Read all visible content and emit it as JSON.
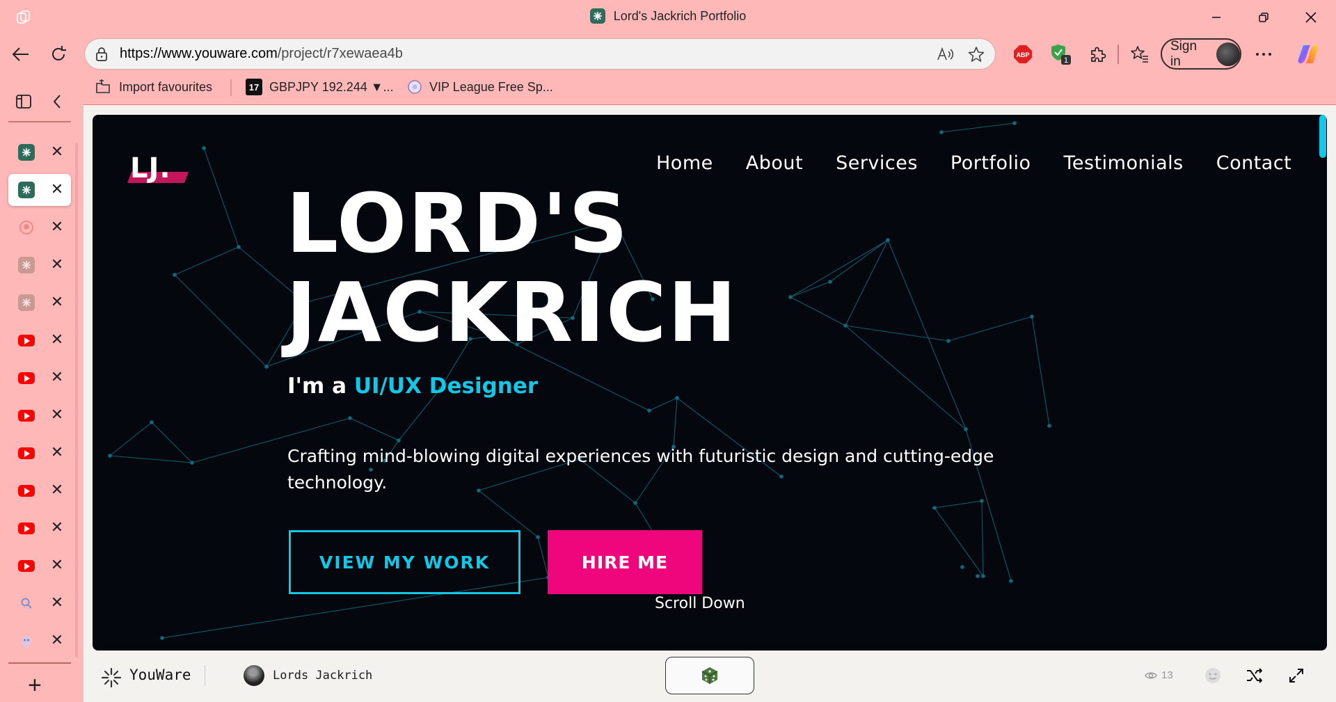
{
  "window": {
    "title": "Lord's Jackrich Portfolio",
    "minimize_icon": "minimize-icon",
    "restore_icon": "restore-icon",
    "close_icon": "close-icon"
  },
  "toolbar": {
    "url_host": "https://www.youware.com",
    "url_path": "/project/r7xewaea4b",
    "signin_label": "Sign in",
    "extension_badge": "1",
    "adblock_label": "ABP"
  },
  "favourites": [
    {
      "label": "Import favourites",
      "icon": "import-icon"
    },
    {
      "label": "GBPJPY 192.244 ▼...",
      "icon": "tradingview-icon",
      "badge": "17"
    },
    {
      "label": "VIP League Free Sp...",
      "icon": "vipleague-icon"
    }
  ],
  "sidebar": {
    "tabs": [
      {
        "icon": "youware-icon",
        "active": false
      },
      {
        "icon": "youware-icon",
        "active": true
      },
      {
        "icon": "github-icon",
        "active": false
      },
      {
        "icon": "youware-faded-icon",
        "active": false
      },
      {
        "icon": "youware-faded-icon",
        "active": false
      },
      {
        "icon": "youtube-icon",
        "active": false
      },
      {
        "icon": "youtube-icon",
        "active": false
      },
      {
        "icon": "youtube-icon",
        "active": false
      },
      {
        "icon": "youtube-icon",
        "active": false
      },
      {
        "icon": "youtube-icon",
        "active": false
      },
      {
        "icon": "youtube-icon",
        "active": false
      },
      {
        "icon": "youtube-icon",
        "active": false
      },
      {
        "icon": "search-icon",
        "active": false
      },
      {
        "icon": "robot-icon",
        "active": false
      }
    ],
    "close_glyph": "✕",
    "add_glyph": "+"
  },
  "hero": {
    "logo_text": "LJ.",
    "nav": [
      "Home",
      "About",
      "Services",
      "Portfolio",
      "Testimonials",
      "Contact"
    ],
    "heading_line1": "LORD'S",
    "heading_line2": "JACKRICH",
    "subtitle_prefix": "I'm a ",
    "subtitle_role": "UI/UX Designer",
    "description": "Crafting mind-blowing digital experiences with futuristic design and cutting-edge technology.",
    "primary_button": "VIEW MY WORK",
    "secondary_button": "HIRE ME",
    "scroll_label": "Scroll Down",
    "colors": {
      "background": "#05070f",
      "accent": "#13c8e6",
      "pink": "#f0067c",
      "network": "#0f6b7a"
    }
  },
  "bottombar": {
    "brand": "YouWare",
    "creator": "Lords Jackrich",
    "views": "13",
    "icons": [
      "youware-logo-icon",
      "dice-icon",
      "eye-icon",
      "emoji-icon",
      "shuffle-icon",
      "expand-icon"
    ]
  }
}
